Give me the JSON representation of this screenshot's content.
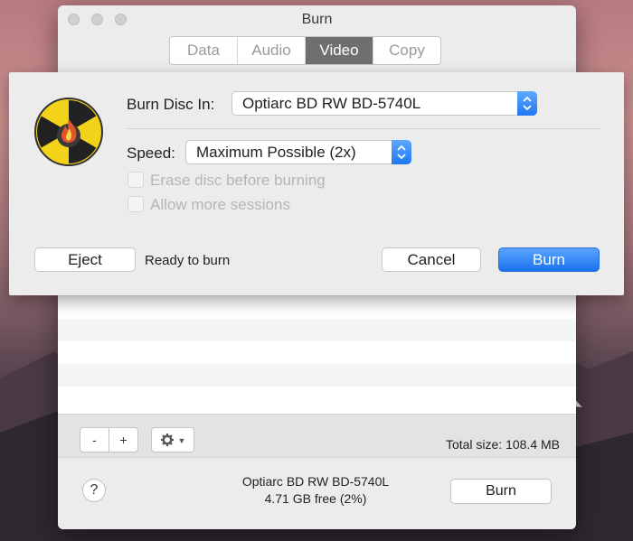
{
  "window": {
    "title": "Burn"
  },
  "tabs": [
    {
      "label": "Data",
      "active": false
    },
    {
      "label": "Audio",
      "active": false
    },
    {
      "label": "Video",
      "active": true
    },
    {
      "label": "Copy",
      "active": false
    }
  ],
  "sheet": {
    "burn_disc_label": "Burn Disc In:",
    "drive_value": "Optiarc BD RW BD-5740L",
    "speed_label": "Speed:",
    "speed_value": "Maximum Possible (2x)",
    "erase_label": "Erase disc before burning",
    "erase_checked": false,
    "sessions_label": "Allow more sessions",
    "sessions_checked": false,
    "eject_label": "Eject",
    "status": "Ready to burn",
    "cancel_label": "Cancel",
    "burn_label": "Burn",
    "accent_color": "#1f78f1"
  },
  "toolbar": {
    "remove_label": "-",
    "add_label": "+",
    "gear_icon": "gear-icon",
    "total_size": "Total size: 108.4 MB"
  },
  "footer": {
    "help_label": "?",
    "drive_name": "Optiarc BD RW BD-5740L",
    "free_space": "4.71 GB free (2%)",
    "burn_label": "Burn"
  }
}
